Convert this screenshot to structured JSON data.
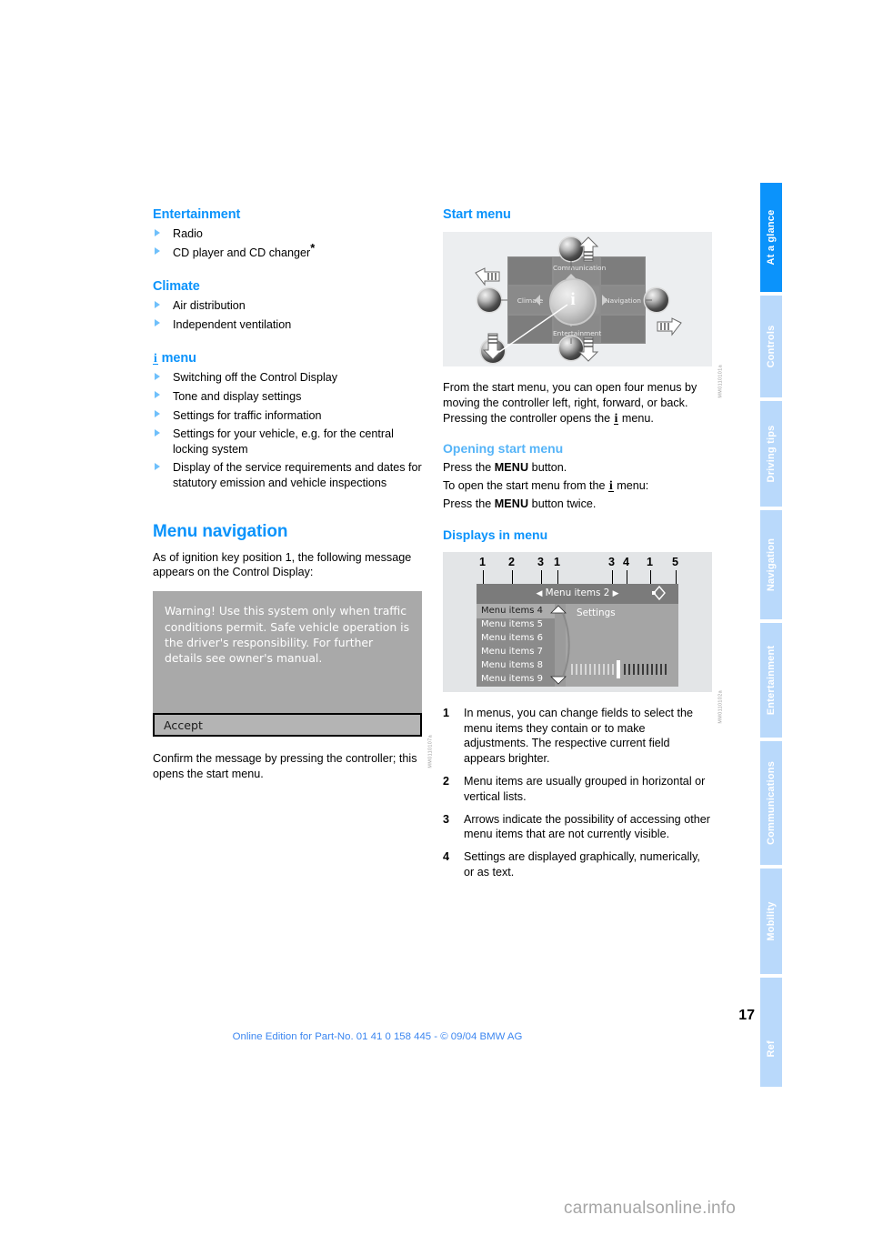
{
  "document": {
    "page_number": "17",
    "footer": "Online Edition for Part-No. 01 41 0 158 445 - © 09/04 BMW AG",
    "watermark": "carmanualsonline.info"
  },
  "sidebar": {
    "tabs": [
      {
        "label": "At a glance",
        "active": true
      },
      {
        "label": "Controls",
        "active": false
      },
      {
        "label": "Driving tips",
        "active": false
      },
      {
        "label": "Navigation",
        "active": false
      },
      {
        "label": "Entertainment",
        "active": false
      },
      {
        "label": "Communications",
        "active": false
      },
      {
        "label": "Mobility",
        "active": false
      },
      {
        "label": "Reference",
        "active": false
      }
    ],
    "colors": {
      "active": "#0b93fb",
      "inactive": "#b9d9fb",
      "label": "#ffffff"
    }
  },
  "left_column": {
    "entertainment": {
      "heading": "Entertainment",
      "items": [
        "Radio",
        "CD player and CD changer"
      ],
      "star": "*"
    },
    "climate": {
      "heading": "Climate",
      "items": [
        "Air distribution",
        "Independent ventilation"
      ]
    },
    "i_menu": {
      "heading_icon": "i",
      "heading": "menu",
      "items": [
        "Switching off the Control Display",
        "Tone and display settings",
        "Settings for traffic information",
        "Settings for your vehicle, e.g. for the central locking system",
        "Display of the service requirements and dates for statutory emission and vehicle inspections"
      ]
    },
    "menu_navigation": {
      "heading": "Menu navigation",
      "intro": "As of ignition key position 1, the following message appears on the Control Display:",
      "figure": {
        "warning_text": "Warning! Use this system only when traffic conditions permit. Safe vehicle operation is the driver's responsibility. For further details see owner's manual.",
        "accept_label": "Accept",
        "code": "MM0110107a"
      },
      "after_figure": "Confirm the message by pressing the controller; this opens the start menu."
    }
  },
  "right_column": {
    "start_menu": {
      "heading": "Start menu",
      "figure": {
        "menu_labels": [
          "Communication",
          "Climate",
          "Navigation",
          "Entertainment"
        ],
        "center_icon": "i",
        "code": "MM0110101a"
      },
      "paragraph_1_a": "From the start menu, you can open four menus by moving the controller left, right, forward, or back. Pressing the controller opens the ",
      "paragraph_1_icon": "i",
      "paragraph_1_b": " menu."
    },
    "opening_start_menu": {
      "heading": "Opening start menu",
      "line_1_a": "Press the ",
      "line_1_button": "MENU",
      "line_1_b": " button.",
      "line_2_a": "To open the start menu from the ",
      "line_2_icon": "i",
      "line_2_b": " menu:",
      "line_3_a": "Press the ",
      "line_3_button": "MENU",
      "line_3_b": " button twice."
    },
    "displays_in_menu": {
      "heading": "Displays in menu",
      "figure": {
        "callout_numbers": [
          "1",
          "2",
          "3",
          "1",
          "3",
          "4",
          "1",
          "5"
        ],
        "header_title": "Menu items 2",
        "list_items": [
          "Menu items 4",
          "Menu items 5",
          "Menu items 6",
          "Menu items 7",
          "Menu items 8",
          "Menu items 9"
        ],
        "panel_title": "Settings",
        "code": "MM0110102a"
      },
      "numbered_items": [
        {
          "n": "1",
          "text": "In menus, you can change fields to select the menu items they contain or to make adjustments. The respective current field appears brighter."
        },
        {
          "n": "2",
          "text": "Menu items are usually grouped in horizontal or vertical lists."
        },
        {
          "n": "3",
          "text": "Arrows indicate the possibility of accessing other menu items that are not currently visible."
        },
        {
          "n": "4",
          "text": "Settings are displayed graphically, numerically, or as text."
        }
      ]
    }
  }
}
